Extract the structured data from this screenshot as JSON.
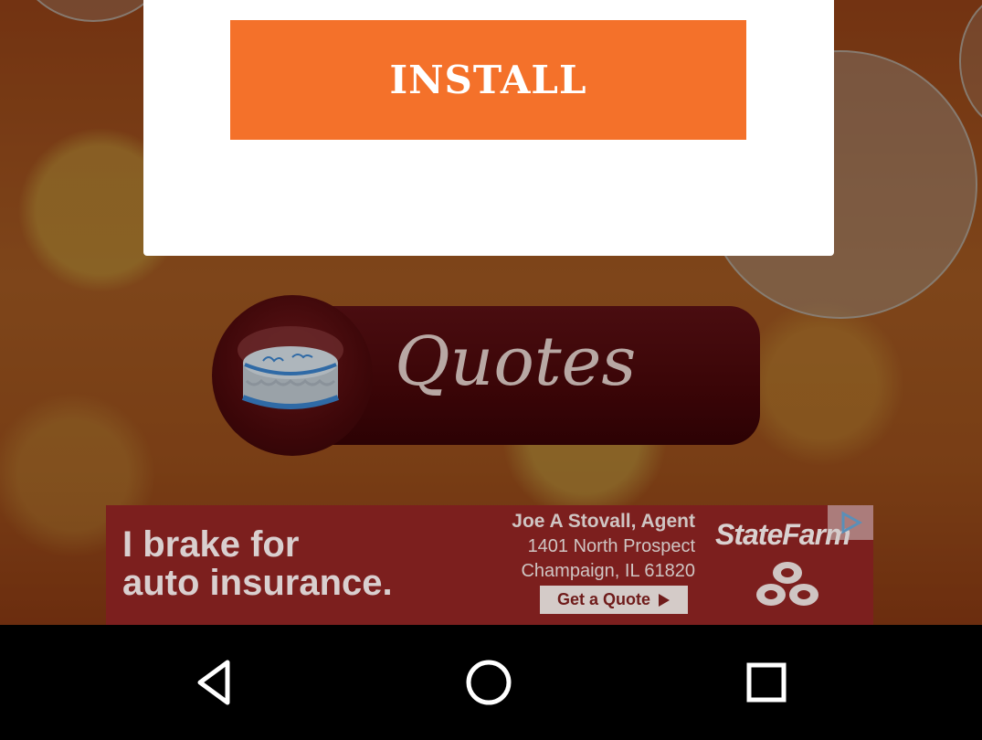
{
  "dialog": {
    "install_label": "INSTALL"
  },
  "quotes_button": {
    "label": "Quotes",
    "icon": "birthday-cake-icon"
  },
  "ad": {
    "headline_line1": "I brake for",
    "headline_line2": "auto insurance.",
    "agent_name": "Joe A Stovall, Agent",
    "agent_address1": "1401 North Prospect",
    "agent_address2": "Champaign, IL 61820",
    "cta": "Get a Quote",
    "brand": "StateFarm",
    "adchoices_icon": "adchoices-icon"
  },
  "navbar": {
    "back_icon": "back-icon",
    "home_icon": "home-icon",
    "recents_icon": "recents-icon"
  },
  "colors": {
    "install_orange": "#f4712a",
    "ad_red": "#7c1f1e",
    "quotes_maroon": "#3a0507"
  }
}
